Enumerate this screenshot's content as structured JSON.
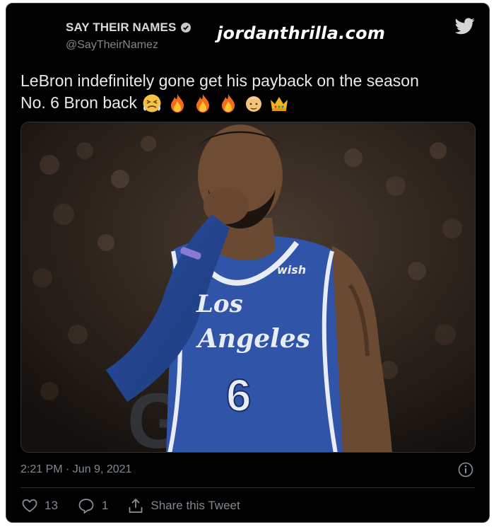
{
  "tweet": {
    "display_name": "SAY THEIR NAMES",
    "handle": "@SayTheirNamez",
    "watermark": "jordanthrilla.com",
    "text_line1": "LeBron indefinitely gone get his payback on the season",
    "text_line2": "No. 6 Bron back",
    "emojis": [
      "persevering-face-icon",
      "fire-icon",
      "fire-icon",
      "fire-icon",
      "old-man-icon",
      "crown-icon"
    ],
    "image": {
      "jersey_wordmark": "wish",
      "jersey_city_line1": "Los",
      "jersey_city_line2": "Angeles",
      "jersey_number": "6",
      "background_letter": "G"
    },
    "timestamp": "2:21 PM · Jun 9, 2021",
    "likes": "13",
    "replies": "1",
    "share_label": "Share this Tweet"
  },
  "colors": {
    "background": "#000000",
    "text": "#e7e9ea",
    "muted": "#7f8890",
    "jersey": "#2f54a8",
    "jersey_trim": "#e8ecf4"
  }
}
